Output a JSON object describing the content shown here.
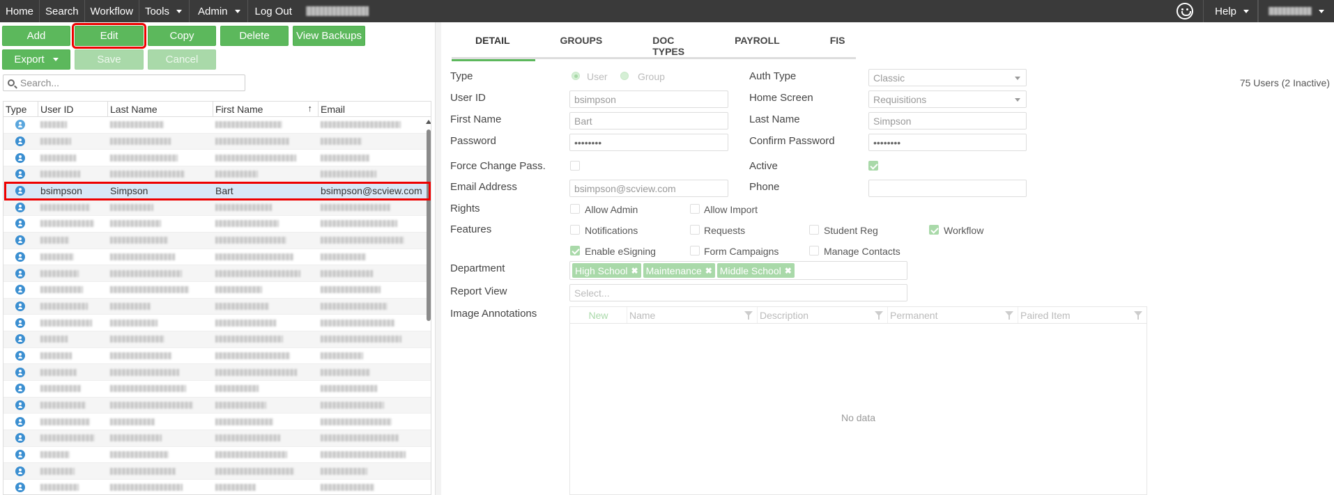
{
  "nav": {
    "items": [
      {
        "label": "Home",
        "dropdown": false
      },
      {
        "label": "Search",
        "dropdown": false
      },
      {
        "label": "Workflow",
        "dropdown": false
      },
      {
        "label": "Tools",
        "dropdown": true
      },
      {
        "label": "Admin",
        "dropdown": true
      },
      {
        "label": "Log Out",
        "dropdown": false
      }
    ],
    "help_label": "Help"
  },
  "toolbar": {
    "add": "Add",
    "edit": "Edit",
    "copy": "Copy",
    "delete": "Delete",
    "view_backups": "View Backups",
    "export": "Export",
    "save": "Save",
    "cancel": "Cancel"
  },
  "search": {
    "placeholder": "Search..."
  },
  "user_count": "75 Users (2 Inactive)",
  "grid": {
    "columns": [
      "Type",
      "User ID",
      "Last Name",
      "First Name",
      "Email"
    ],
    "selected_row": {
      "user_id": "bsimpson",
      "last_name": "Simpson",
      "first_name": "Bart",
      "email": "bsimpson@scview.com"
    }
  },
  "tabs": [
    "DETAIL",
    "GROUPS",
    "DOC TYPES",
    "PAYROLL",
    "FIS"
  ],
  "detail": {
    "type_label": "Type",
    "type_user": "User",
    "type_group": "Group",
    "auth_type_label": "Auth Type",
    "auth_type_value": "Classic",
    "user_id_label": "User ID",
    "user_id_value": "bsimpson",
    "home_screen_label": "Home Screen",
    "home_screen_value": "Requisitions",
    "first_name_label": "First Name",
    "first_name_value": "Bart",
    "last_name_label": "Last Name",
    "last_name_value": "Simpson",
    "password_label": "Password",
    "password_value": "••••••••",
    "confirm_password_label": "Confirm Password",
    "confirm_password_value": "••••••••",
    "force_change_label": "Force Change Pass.",
    "active_label": "Active",
    "email_label": "Email Address",
    "email_value": "bsimpson@scview.com",
    "phone_label": "Phone",
    "rights_label": "Rights",
    "allow_admin": "Allow Admin",
    "allow_import": "Allow Import",
    "features_label": "Features",
    "notifications": "Notifications",
    "requests": "Requests",
    "student_reg": "Student Reg",
    "workflow": "Workflow",
    "enable_esigning": "Enable eSigning",
    "form_campaigns": "Form Campaigns",
    "manage_contacts": "Manage Contacts",
    "department_label": "Department",
    "departments": [
      "High School",
      "Maintenance",
      "Middle School"
    ],
    "report_view_label": "Report View",
    "report_view_placeholder": "Select...",
    "image_annotations_label": "Image Annotations",
    "annotation_columns": [
      "New",
      "Name",
      "Description",
      "Permanent",
      "Paired Item"
    ],
    "no_data": "No data"
  }
}
